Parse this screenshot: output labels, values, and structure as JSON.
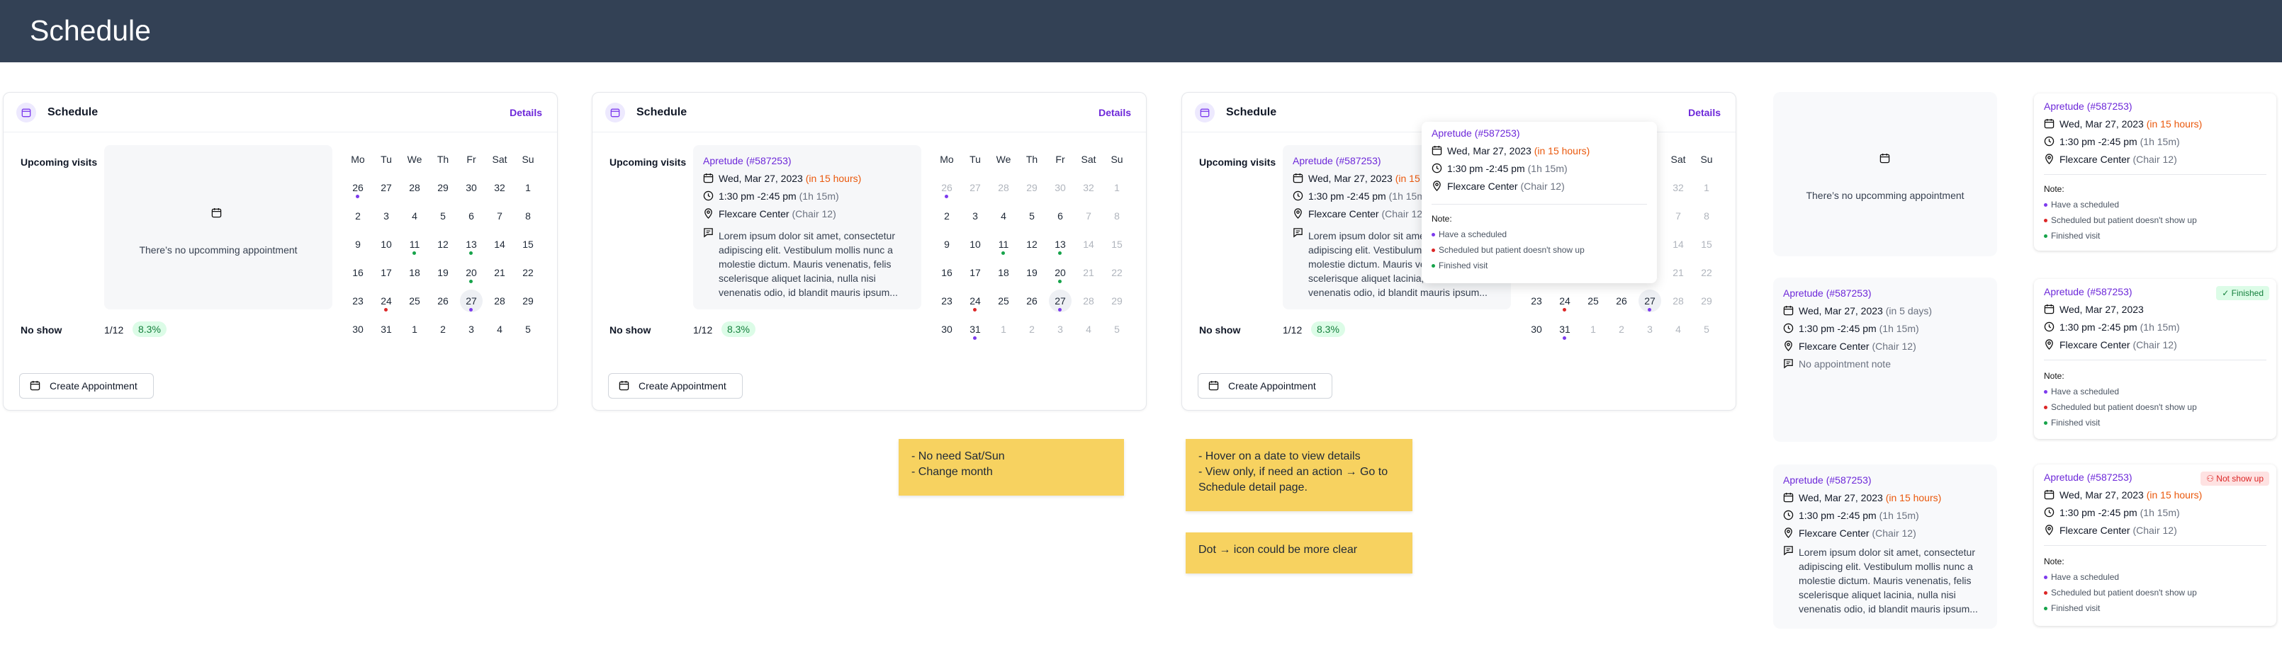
{
  "page_title": "Schedule",
  "card": {
    "title": "Schedule",
    "details": "Details",
    "upcoming": "Upcoming visits",
    "no_show": "No show",
    "no_show_value": "1/12",
    "no_show_pct": "8.3%",
    "create": "Create Appointment"
  },
  "empty_msg": "There’s no upcomming appointment",
  "appt": {
    "title": "Apretude (#587253)",
    "date": "Wed, Mar 27, 2023",
    "rel15": "(in 15 hours)",
    "rel5": "(in 5 days)",
    "time": "1:30 pm -2:45 pm",
    "dur": "(1h 15m)",
    "loc": "Flexcare Center",
    "chair": "(Chair 12)",
    "note": "Lorem ipsum dolor sit amet, consectetur adipiscing elit. Vestibulum mollis nunc a molestie dictum. Mauris venenatis, felis scelerisque aliquet lacinia, nulla nisi venenatis odio, id blandit mauris ipsum...",
    "no_note": "No appointment note"
  },
  "legend": {
    "title": "Note:",
    "items": [
      "Have a scheduled",
      "Scheduled but patient doesn't show up",
      "Finished visit"
    ]
  },
  "badges": {
    "finished": "Finished",
    "notshow": "Not show up"
  },
  "weekdays": [
    "Mo",
    "Tu",
    "We",
    "Th",
    "Fr",
    "Sat",
    "Su"
  ],
  "calendar": [
    [
      "26",
      "27",
      "28",
      "29",
      "30",
      "32",
      "1"
    ],
    [
      "2",
      "3",
      "4",
      "5",
      "6",
      "7",
      "8"
    ],
    [
      "9",
      "10",
      "11",
      "12",
      "13",
      "14",
      "15"
    ],
    [
      "16",
      "17",
      "18",
      "19",
      "20",
      "21",
      "22"
    ],
    [
      "23",
      "24",
      "25",
      "26",
      "27",
      "28",
      "29"
    ],
    [
      "30",
      "31",
      "1",
      "2",
      "3",
      "4",
      "5"
    ]
  ],
  "stickies": {
    "s1": [
      "- No need Sat/Sun",
      "- Change month"
    ],
    "s2": [
      "- Hover on a date to view details",
      "- View only, if need an action → Go to",
      "Schedule detail page."
    ],
    "s3": [
      "Dot → icon could be more clear"
    ]
  },
  "colors": {
    "header": "#334155",
    "accent": "#6d28d9",
    "orange": "#ea580c",
    "green": "#16a34a",
    "red": "#dc2626",
    "purple": "#7c3aed",
    "sticky": "#f7d260"
  }
}
